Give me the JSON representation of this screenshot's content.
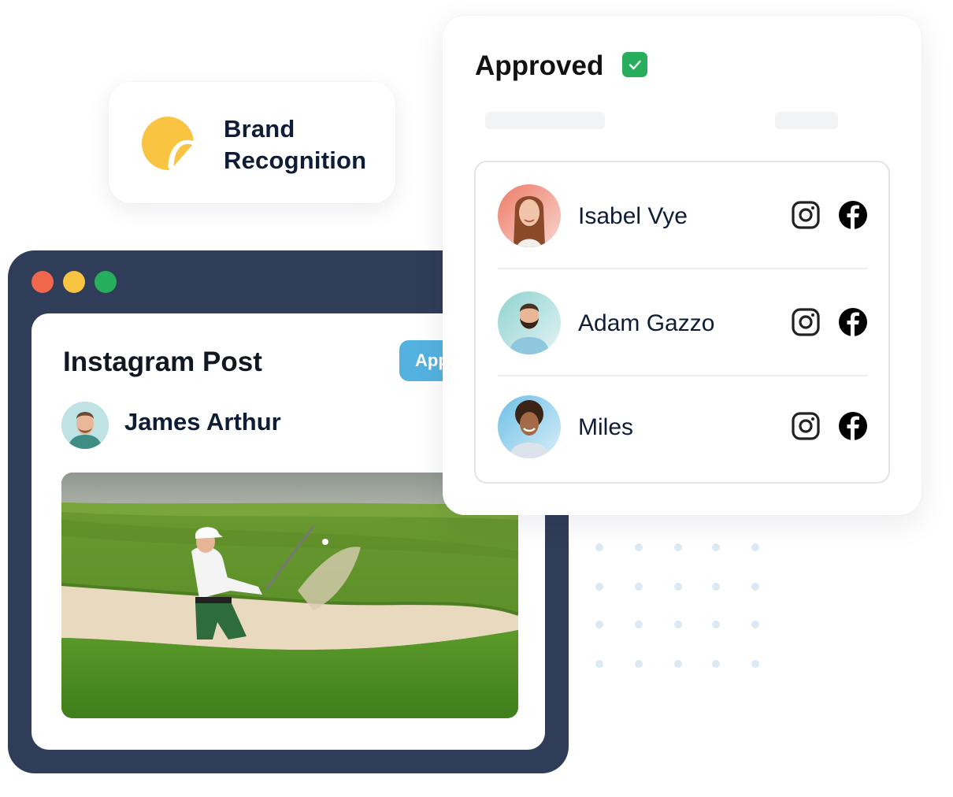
{
  "brand_card": {
    "icon": "sticker-icon",
    "label": "Brand Recognition",
    "accent_color": "#F9C442"
  },
  "window": {
    "controls": [
      "close",
      "minimize",
      "maximize"
    ],
    "post": {
      "title": "Instagram Post",
      "approve_button_label": "Approve",
      "approve_button_visible_text": "App",
      "author": {
        "name": "James Arthur",
        "avatar": "avatar-james-arthur"
      },
      "image": "golfer-bunker-shot-photo"
    }
  },
  "approved_panel": {
    "title": "Approved",
    "status_icon": "check-icon",
    "status_color": "#27AE5C",
    "people": [
      {
        "name": "Isabel Vye",
        "avatar": "avatar-isabel-vye",
        "socials": [
          "instagram-icon",
          "facebook-icon"
        ]
      },
      {
        "name": "Adam Gazzo",
        "avatar": "avatar-adam-gazzo",
        "socials": [
          "instagram-icon",
          "facebook-icon"
        ]
      },
      {
        "name": "Miles",
        "avatar": "avatar-miles",
        "socials": [
          "instagram-icon",
          "facebook-icon"
        ]
      }
    ]
  }
}
